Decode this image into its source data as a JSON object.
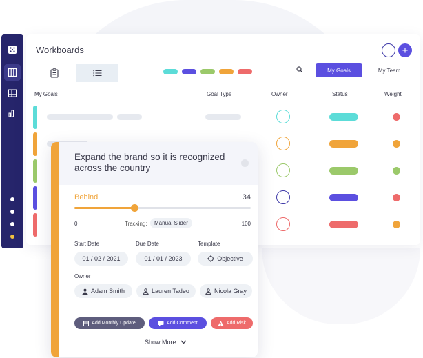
{
  "app": {
    "title": "Workboards"
  },
  "colors": {
    "rail": "#26256b",
    "accent": "#5b4fe0",
    "teal": "#5cdcd8",
    "purple": "#5b4fe0",
    "green": "#9bc96a",
    "orange": "#f0a43a",
    "red": "#ee6b6b"
  },
  "rail": {
    "icons": [
      "grid-icon",
      "board-icon",
      "table-icon",
      "chart-icon"
    ]
  },
  "tabs": [
    {
      "icon": "clipboard-icon"
    },
    {
      "icon": "list-icon"
    }
  ],
  "filters": [
    "teal",
    "purple",
    "green",
    "orange",
    "red"
  ],
  "header": {
    "search_icon": "search-icon",
    "my_goals_label": "My Goals",
    "my_team_label": "My Team"
  },
  "columns": {
    "my_goals": "My Goals",
    "goal_type": "Goal Type",
    "owner": "Owner",
    "status": "Status",
    "weight": "Weight"
  },
  "rows": [
    {
      "color": "#5cdcd8",
      "status_color": "#5cdcd8",
      "weight_color": "#ee6b6b"
    },
    {
      "color": "#f0a43a",
      "status_color": "#f0a43a",
      "weight_color": "#f0a43a"
    },
    {
      "color": "#9bc96a",
      "status_color": "#9bc96a",
      "weight_color": "#9bc96a"
    },
    {
      "color": "#5b4fe0",
      "status_color": "#5b4fe0",
      "weight_color": "#ee6b6b"
    },
    {
      "color": "#ee6b6b",
      "status_color": "#ee6b6b",
      "weight_color": "#f0a43a"
    }
  ],
  "goal": {
    "title": "Expand the brand so it is recognized across the country",
    "status": "Behind",
    "score": "34",
    "progress": 0.34,
    "slider_min": "0",
    "slider_max": "100",
    "tracking_label": "Tracking:",
    "tracking_value": "Manual Slider",
    "start_date_label": "Start Date",
    "start_date": "01 / 02 / 2021",
    "due_date_label": "Due Date",
    "due_date": "01 / 01 / 2023",
    "template_label": "Template",
    "template": "Objective",
    "owner_label": "Owner",
    "owners": [
      "Adam Smith",
      "Lauren Tadeo",
      "Nicola Gray"
    ],
    "actions": {
      "monthly": "Add Monthly Update",
      "comment": "Add Comment",
      "risk": "Add Risk"
    },
    "show_more": "Show More"
  }
}
